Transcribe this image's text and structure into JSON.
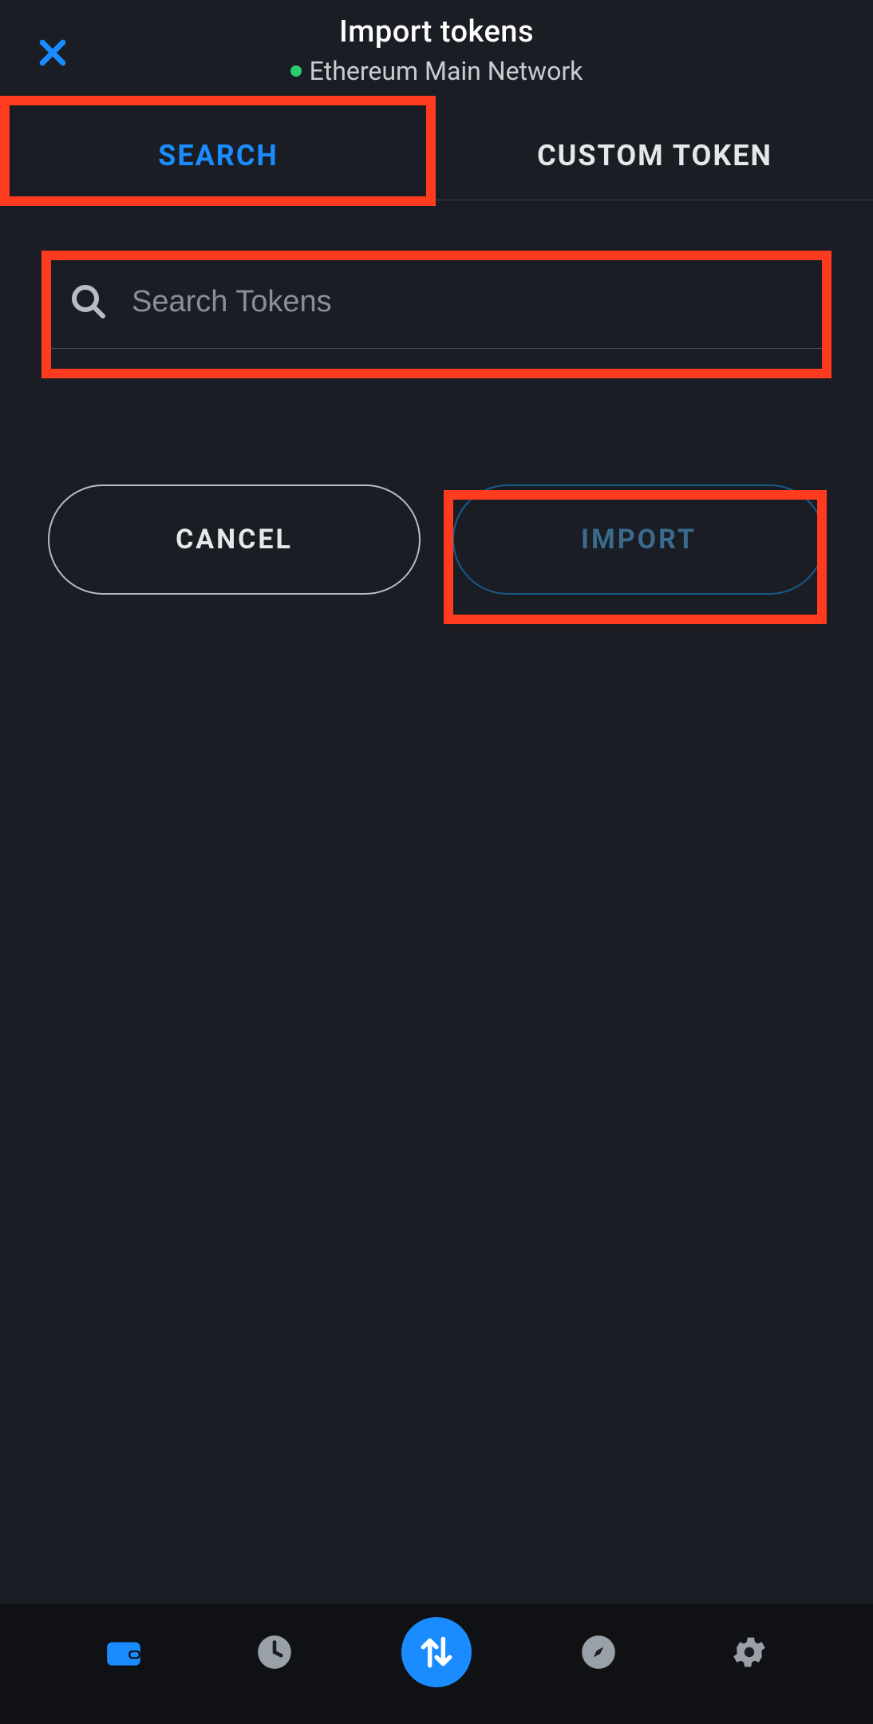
{
  "header": {
    "title": "Import tokens",
    "network": "Ethereum Main Network"
  },
  "tabs": {
    "search": "SEARCH",
    "custom": "CUSTOM TOKEN"
  },
  "search": {
    "placeholder": "Search Tokens"
  },
  "actions": {
    "cancel": "CANCEL",
    "import": "IMPORT"
  },
  "colors": {
    "accent": "#1a8cff",
    "highlight": "#ff3b1f",
    "network_dot": "#2ecc71"
  }
}
